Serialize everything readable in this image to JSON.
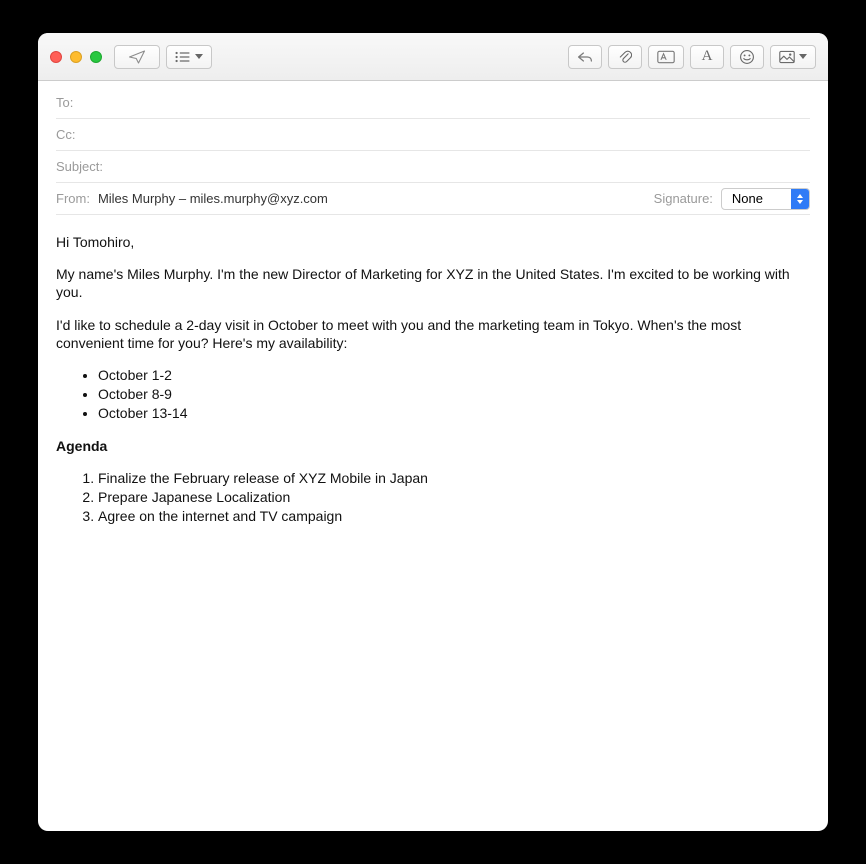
{
  "header": {
    "to_label": "To:",
    "cc_label": "Cc:",
    "subject_label": "Subject:",
    "from_label": "From:",
    "from_value": "Miles Murphy – miles.murphy@xyz.com",
    "signature_label": "Signature:",
    "signature_value": "None"
  },
  "toolbar": {
    "icons": {
      "send": "send-icon",
      "header_toggle": "header-list-icon",
      "reply": "reply-icon",
      "attach": "paperclip-icon",
      "markup": "markup-icon",
      "font": "font-icon",
      "emoji": "emoji-icon",
      "photo": "photo-icon"
    }
  },
  "body": {
    "greeting": "Hi Tomohiro,",
    "p1": "My name's Miles Murphy. I'm the new Director of Marketing for XYZ in the United States. I'm excited to be working with you.",
    "p2": "I'd like to schedule a 2-day visit in October to meet with you and the marketing team in Tokyo. When's the most convenient time for you? Here's my availability:",
    "availability": [
      "October 1-2",
      "October 8-9",
      "October 13-14"
    ],
    "agenda_heading": "Agenda",
    "agenda": [
      "Finalize the February release of XYZ Mobile in Japan",
      "Prepare Japanese Localization",
      "Agree on the internet and TV campaign"
    ]
  }
}
